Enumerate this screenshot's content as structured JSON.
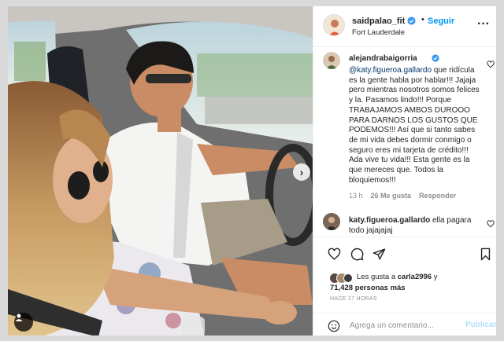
{
  "post": {
    "owner": {
      "username": "saidpalao_fit",
      "follow_label": "Seguir",
      "separator": "•",
      "location": "Fort Lauderdale",
      "more_label": "···"
    },
    "photo": {
      "next_label": "›"
    },
    "comments": [
      {
        "username": "alejandrabaigorria",
        "mention": "@katy.figueroa.gallardo",
        "text": " que ridícula es la gente habla por hablar!!! Jajaja pero mientras nosotros somos felices y la. Pasamos lindo!!! Porque TRABAJAMOS AMBOS DUROOO PARA DARNOS LOS GUSTOS QUE PODEMOS!!! Así que si tanto sabes de mi vida debes dormir conmigo o seguro eres mi tarjeta de crédito!!! Ada vive tu vida!!! Esta gente es la que mereces que. Todos la bloquiemos!!!",
        "time": "13 h",
        "likes": "26 Me gusta",
        "reply_label": "Responder"
      },
      {
        "username": "katy.figueroa.gallardo",
        "text": " ella pagara todo jajajajaj"
      }
    ],
    "likes_line1_prefix": "Les gusta a ",
    "likes_user": "carla2996",
    "likes_line1_suffix": " y",
    "likes_line2": "71,428 personas más",
    "timestamp": "HACE 17 HORAS",
    "comment_placeholder": "Agrega un comentario...",
    "publish_label": "Publicar"
  },
  "colors": {
    "accent": "#0095f6",
    "verified": "#3897f0",
    "publish_disabled": "#b2dffc",
    "text_secondary": "#8e8e8e"
  },
  "icons": [
    "verified-icon",
    "heart-icon",
    "comment-icon",
    "share-icon",
    "bookmark-icon",
    "emoji-icon",
    "user-tag-icon",
    "chevron-right-icon"
  ]
}
